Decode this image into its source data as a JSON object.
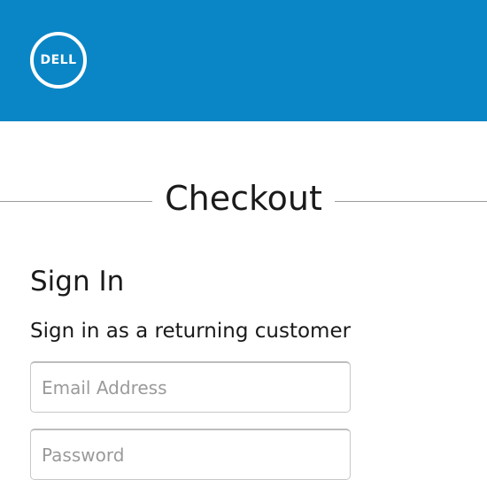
{
  "header": {
    "brand_color": "#0a86c6",
    "logo_text": "DELL"
  },
  "checkout": {
    "title": "Checkout"
  },
  "signin": {
    "heading": "Sign In",
    "subheading": "Sign in as a returning customer",
    "email_placeholder": "Email Address",
    "email_value": "",
    "password_placeholder": "Password",
    "password_value": ""
  }
}
